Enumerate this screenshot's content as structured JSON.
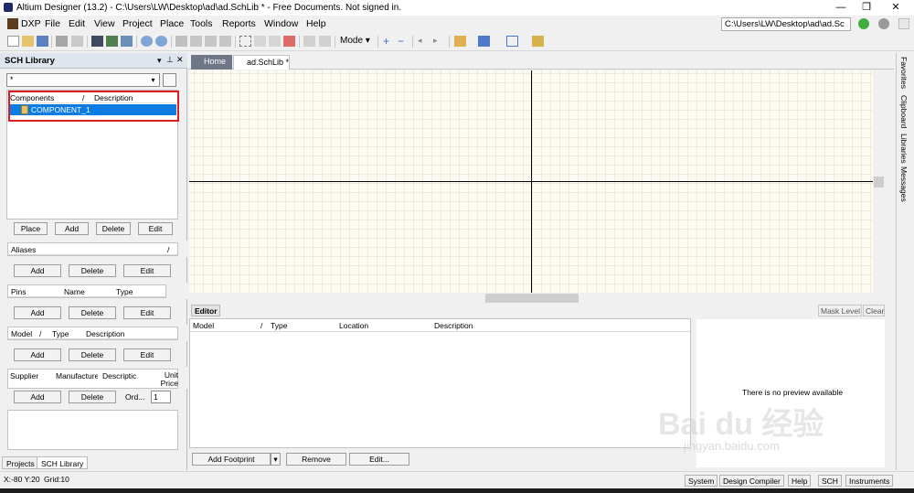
{
  "window": {
    "title": "Altium Designer (13.2) - C:\\Users\\LW\\Desktop\\ad\\ad.SchLib * - Free Documents. Not signed in.",
    "minimize_glyph": "—",
    "restore_glyph": "❐",
    "close_glyph": "✕"
  },
  "menu": {
    "items": [
      "DXP",
      "File",
      "Edit",
      "View",
      "Project",
      "Place",
      "Tools",
      "Reports",
      "Window",
      "Help"
    ],
    "path": "C:\\Users\\LW\\Desktop\\ad\\ad.Sc"
  },
  "toolbar": {
    "mode_label": "Mode ▾"
  },
  "left_panel": {
    "title": "SCH Library",
    "filter_value": "*",
    "components_header": "Components",
    "description_header": "Description",
    "sort_glyph": "/",
    "selected_component": "COMPONENT_1",
    "component_buttons": [
      "Place",
      "Add",
      "Delete",
      "Edit"
    ],
    "aliases_header": "Aliases",
    "aliases_buttons": [
      "Add",
      "Delete",
      "Edit"
    ],
    "pins_headers": [
      "Pins",
      "Name",
      "Type"
    ],
    "pins_buttons": [
      "Add",
      "Delete",
      "Edit"
    ],
    "model_headers": [
      "Model",
      "/",
      "Type",
      "Description"
    ],
    "model_buttons": [
      "Add",
      "Delete",
      "Edit"
    ],
    "supplier_headers": [
      "Supplier",
      "Manufacture",
      "Descriptic",
      "Unit Price"
    ],
    "supplier_buttons": [
      "Add",
      "Delete",
      "Ord..."
    ],
    "order_qty": "1",
    "bottom_tabs": [
      "Projects",
      "SCH Library"
    ]
  },
  "doc_tabs": {
    "home": "Home",
    "schlib": "ad.SchLib *"
  },
  "right_tabs": [
    "Favorites",
    "Clipboard",
    "Libraries",
    "Messages"
  ],
  "editor": {
    "tab": "Editor",
    "mask_level": "Mask Level",
    "clear": "Clear",
    "columns": [
      "Model",
      "/",
      "Type",
      "Location",
      "Description"
    ],
    "preview_text": "There is no preview available",
    "buttons": {
      "add_footprint": "Add Footprint",
      "remove": "Remove",
      "edit": "Edit..."
    }
  },
  "status": {
    "coords": "X:-80 Y:20",
    "grid": "Grid:10",
    "buttons": [
      "System",
      "Design Compiler",
      "Help",
      "SCH",
      "Instruments"
    ]
  },
  "watermark": {
    "brand": "Bai du 经验",
    "url": "jingyan.baidu.com"
  }
}
